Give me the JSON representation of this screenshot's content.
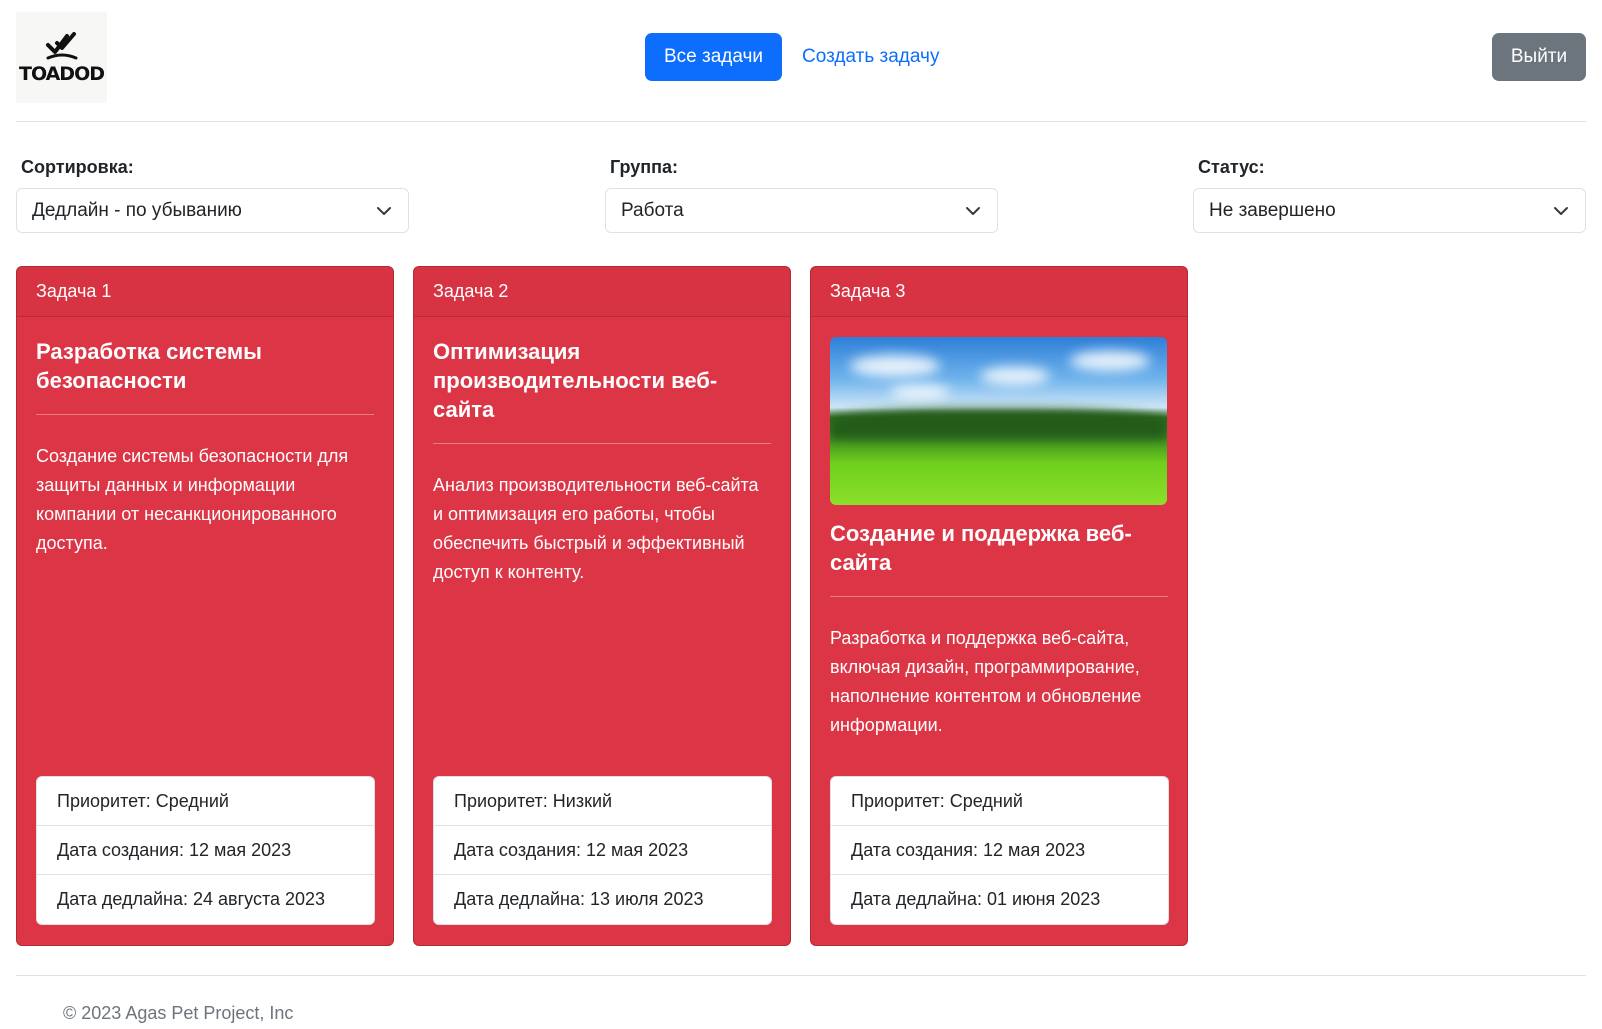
{
  "header": {
    "logo_text": "TOADOD",
    "nav_all_tasks": "Все задачи",
    "nav_create_task": "Создать задачу",
    "logout": "Выйти",
    "colors": {
      "primary": "#0d6efd",
      "secondary": "#6c757d"
    }
  },
  "filters": {
    "sort": {
      "label": "Сортировка:",
      "value": "Дедлайн - по убыванию"
    },
    "group": {
      "label": "Группа:",
      "value": "Работа"
    },
    "status": {
      "label": "Статус:",
      "value": "Не завершено"
    }
  },
  "cards": [
    {
      "header": "Задача 1",
      "title": "Разработка системы безопасности",
      "description": "Создание системы безопасности для защиты данных и информации компании от несанкционированного доступа.",
      "has_image": false,
      "priority": "Приоритет: Средний",
      "created": "Дата создания: 12 мая 2023",
      "deadline": "Дата дедлайна: 24 августа 2023"
    },
    {
      "header": "Задача 2",
      "title": "Оптимизация производительности веб-сайта",
      "description": "Анализ производительности веб-сайта и оптимизация его работы, чтобы обеспечить быстрый и эффективный доступ к контенту.",
      "has_image": false,
      "priority": "Приоритет: Низкий",
      "created": "Дата создания: 12 мая 2023",
      "deadline": "Дата дедлайна: 13 июля 2023"
    },
    {
      "header": "Задача 3",
      "title": "Создание и поддержка веб-сайта",
      "description": "Разработка и поддержка веб-сайта, включая дизайн, программирование, наполнение контентом и обновление информации.",
      "has_image": true,
      "priority": "Приоритет: Средний",
      "created": "Дата создания: 12 мая 2023",
      "deadline": "Дата дедлайна: 01 июня 2023"
    }
  ],
  "card_color": "#dc3545",
  "footer": {
    "text": "© 2023 Agas Pet Project, Inc"
  }
}
